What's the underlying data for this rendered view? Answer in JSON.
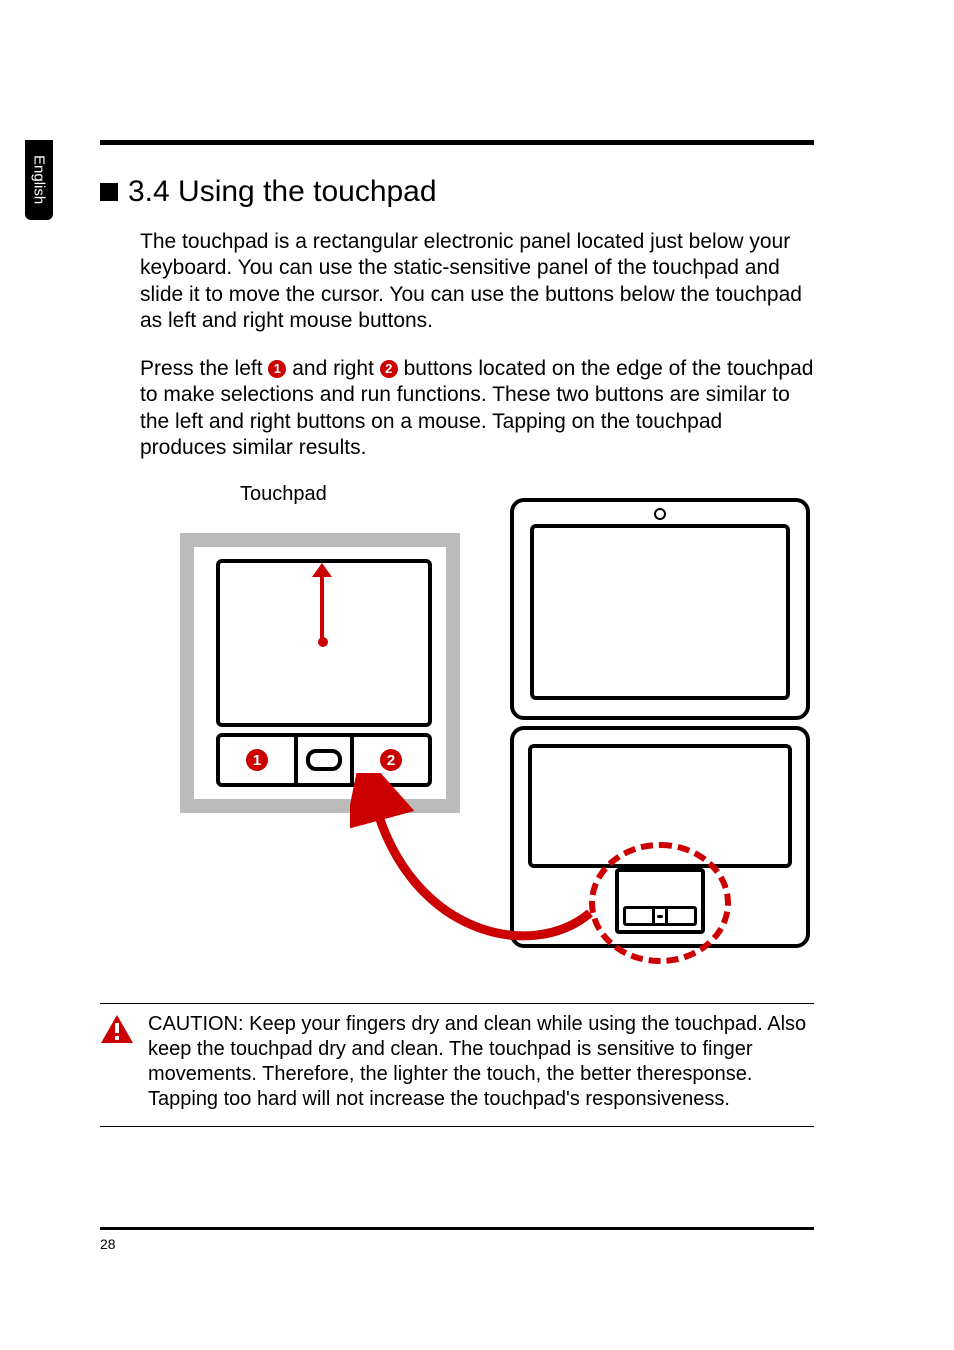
{
  "sideTab": "English",
  "heading": "3.4 Using the touchpad",
  "para1": "The touchpad is a rectangular electronic panel located just below your keyboard. You can use the static-sensitive panel of the touchpad and slide it to move the cursor. You can use the buttons below the touchpad as left and right mouse buttons.",
  "para2a": "Press the left ",
  "para2b": " and right ",
  "para2c": " buttons located on the edge of the touchpad to make selections and run functions. These two buttons are similar to the left and right buttons on a mouse. Tapping on the touchpad produces similar results.",
  "callouts": {
    "one": "1",
    "two": "2"
  },
  "diagram": {
    "touchpadLabel": "Touchpad"
  },
  "caution": "CAUTION: Keep your fingers dry and clean while using the touchpad. Also keep the touchpad dry and clean. The touchpad is sensitive to finger movements. Therefore, the lighter the touch, the better theresponse. Tapping too hard will not increase the touchpad's responsiveness.",
  "pageNumber": "28"
}
